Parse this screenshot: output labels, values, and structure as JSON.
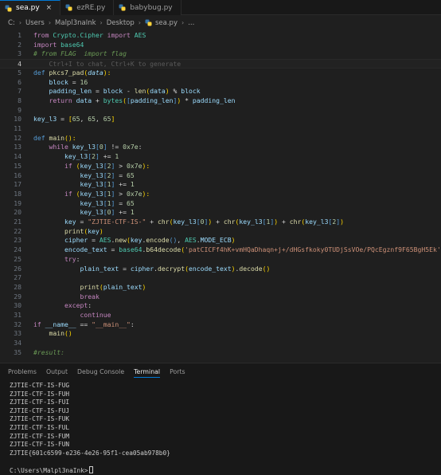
{
  "tabs": [
    {
      "label": "sea.py",
      "active": true
    },
    {
      "label": "ezRE.py",
      "active": false
    },
    {
      "label": "babybug.py",
      "active": false
    }
  ],
  "breadcrumb": [
    "C:",
    "Users",
    "Malpl3naInk",
    "Desktop",
    "sea.py",
    "..."
  ],
  "code_lines": [
    [
      [
        "kw",
        "from "
      ],
      [
        "cls",
        "Crypto.Cipher"
      ],
      [
        "kw",
        " import "
      ],
      [
        "cls",
        "AES"
      ]
    ],
    [
      [
        "kw",
        "import "
      ],
      [
        "cls",
        "base64"
      ]
    ],
    [
      [
        "cmt",
        "# from FLAG  import flag"
      ]
    ],
    [
      [
        "hint",
        "    Ctrl+I to chat, Ctrl+K to generate"
      ]
    ],
    [
      [
        "kb",
        "def "
      ],
      [
        "fn",
        "pkcs7_pad"
      ],
      [
        "pl",
        "("
      ],
      [
        "par",
        "data"
      ],
      [
        "pl",
        "):"
      ]
    ],
    [
      [
        "t",
        "    "
      ],
      [
        "var",
        "block"
      ],
      [
        "op",
        " = "
      ],
      [
        "num",
        "16"
      ]
    ],
    [
      [
        "t",
        "    "
      ],
      [
        "var",
        "padding_len"
      ],
      [
        "op",
        " = "
      ],
      [
        "var",
        "block"
      ],
      [
        "op",
        " - "
      ],
      [
        "fn",
        "len"
      ],
      [
        "pl",
        "("
      ],
      [
        "var",
        "data"
      ],
      [
        "pl",
        ")"
      ],
      [
        "op",
        " % "
      ],
      [
        "var",
        "block"
      ]
    ],
    [
      [
        "t",
        "    "
      ],
      [
        "kw",
        "return "
      ],
      [
        "var",
        "data"
      ],
      [
        "op",
        " + "
      ],
      [
        "cls",
        "bytes"
      ],
      [
        "pl",
        "("
      ],
      [
        "kb",
        "["
      ],
      [
        "var",
        "padding_len"
      ],
      [
        "kb",
        "]"
      ],
      [
        "pl",
        ")"
      ],
      [
        "op",
        " * "
      ],
      [
        "var",
        "padding_len"
      ]
    ],
    [],
    [
      [
        "var",
        "key_l3"
      ],
      [
        "op",
        " = "
      ],
      [
        "pl",
        "["
      ],
      [
        "num",
        "65"
      ],
      [
        "op",
        ", "
      ],
      [
        "num",
        "65"
      ],
      [
        "op",
        ", "
      ],
      [
        "num",
        "65"
      ],
      [
        "pl",
        "]"
      ]
    ],
    [],
    [
      [
        "kb",
        "def "
      ],
      [
        "fn",
        "main"
      ],
      [
        "pl",
        "():"
      ]
    ],
    [
      [
        "t",
        "    "
      ],
      [
        "kw",
        "while "
      ],
      [
        "var",
        "key_l3"
      ],
      [
        "kb",
        "["
      ],
      [
        "num",
        "0"
      ],
      [
        "kb",
        "]"
      ],
      [
        "op",
        " != "
      ],
      [
        "num",
        "0x7e"
      ],
      [
        "op",
        ":"
      ]
    ],
    [
      [
        "t",
        "        "
      ],
      [
        "var",
        "key_l3"
      ],
      [
        "kb",
        "["
      ],
      [
        "num",
        "2"
      ],
      [
        "kb",
        "]"
      ],
      [
        "op",
        " += "
      ],
      [
        "num",
        "1"
      ]
    ],
    [
      [
        "t",
        "        "
      ],
      [
        "kw",
        "if "
      ],
      [
        "pl",
        "("
      ],
      [
        "var",
        "key_l3"
      ],
      [
        "kb",
        "["
      ],
      [
        "num",
        "2"
      ],
      [
        "kb",
        "]"
      ],
      [
        "op",
        " > "
      ],
      [
        "num",
        "0x7e"
      ],
      [
        "pl",
        "):"
      ]
    ],
    [
      [
        "t",
        "            "
      ],
      [
        "var",
        "key_l3"
      ],
      [
        "kb",
        "["
      ],
      [
        "num",
        "2"
      ],
      [
        "kb",
        "]"
      ],
      [
        "op",
        " = "
      ],
      [
        "num",
        "65"
      ]
    ],
    [
      [
        "t",
        "            "
      ],
      [
        "var",
        "key_l3"
      ],
      [
        "kb",
        "["
      ],
      [
        "num",
        "1"
      ],
      [
        "kb",
        "]"
      ],
      [
        "op",
        " += "
      ],
      [
        "num",
        "1"
      ]
    ],
    [
      [
        "t",
        "        "
      ],
      [
        "kw",
        "if "
      ],
      [
        "pl",
        "("
      ],
      [
        "var",
        "key_l3"
      ],
      [
        "kb",
        "["
      ],
      [
        "num",
        "1"
      ],
      [
        "kb",
        "]"
      ],
      [
        "op",
        " > "
      ],
      [
        "num",
        "0x7e"
      ],
      [
        "pl",
        "):"
      ]
    ],
    [
      [
        "t",
        "            "
      ],
      [
        "var",
        "key_l3"
      ],
      [
        "kb",
        "["
      ],
      [
        "num",
        "1"
      ],
      [
        "kb",
        "]"
      ],
      [
        "op",
        " = "
      ],
      [
        "num",
        "65"
      ]
    ],
    [
      [
        "t",
        "            "
      ],
      [
        "var",
        "key_l3"
      ],
      [
        "kb",
        "["
      ],
      [
        "num",
        "0"
      ],
      [
        "kb",
        "]"
      ],
      [
        "op",
        " += "
      ],
      [
        "num",
        "1"
      ]
    ],
    [
      [
        "t",
        "        "
      ],
      [
        "var",
        "key"
      ],
      [
        "op",
        " = "
      ],
      [
        "str",
        "\"ZJTIE-CTF-IS-\""
      ],
      [
        "op",
        " + "
      ],
      [
        "fn",
        "chr"
      ],
      [
        "pl",
        "("
      ],
      [
        "var",
        "key_l3"
      ],
      [
        "kb",
        "["
      ],
      [
        "num",
        "0"
      ],
      [
        "kb",
        "]"
      ],
      [
        "pl",
        ")"
      ],
      [
        "op",
        " + "
      ],
      [
        "fn",
        "chr"
      ],
      [
        "pl",
        "("
      ],
      [
        "var",
        "key_l3"
      ],
      [
        "kb",
        "["
      ],
      [
        "num",
        "1"
      ],
      [
        "kb",
        "]"
      ],
      [
        "pl",
        ")"
      ],
      [
        "op",
        " + "
      ],
      [
        "fn",
        "chr"
      ],
      [
        "pl",
        "("
      ],
      [
        "var",
        "key_l3"
      ],
      [
        "kb",
        "["
      ],
      [
        "num",
        "2"
      ],
      [
        "kb",
        "]"
      ],
      [
        "pl",
        ")"
      ]
    ],
    [
      [
        "t",
        "        "
      ],
      [
        "fn",
        "print"
      ],
      [
        "pl",
        "("
      ],
      [
        "var",
        "key"
      ],
      [
        "pl",
        ")"
      ]
    ],
    [
      [
        "t",
        "        "
      ],
      [
        "var",
        "cipher"
      ],
      [
        "op",
        " = "
      ],
      [
        "cls",
        "AES"
      ],
      [
        "op",
        "."
      ],
      [
        "fn",
        "new"
      ],
      [
        "pl",
        "("
      ],
      [
        "var",
        "key"
      ],
      [
        "op",
        "."
      ],
      [
        "fn",
        "encode"
      ],
      [
        "kb",
        "()"
      ],
      [
        "op",
        ", "
      ],
      [
        "cls",
        "AES"
      ],
      [
        "op",
        "."
      ],
      [
        "var",
        "MODE_ECB"
      ],
      [
        "pl",
        ")"
      ]
    ],
    [
      [
        "t",
        "        "
      ],
      [
        "var",
        "encode_text"
      ],
      [
        "op",
        " = "
      ],
      [
        "cls",
        "base64"
      ],
      [
        "op",
        "."
      ],
      [
        "fn",
        "b64decode"
      ],
      [
        "pl",
        "("
      ],
      [
        "str",
        "'patCICFf4hK+vmHQaDhaqn+j+/dHGsfkoky0TUDjSsVOe/PQcEgznf9F65BgH5Ek'"
      ],
      [
        "pl",
        ")"
      ]
    ],
    [
      [
        "t",
        "        "
      ],
      [
        "kw",
        "try"
      ],
      [
        "op",
        ":"
      ]
    ],
    [
      [
        "t",
        "            "
      ],
      [
        "var",
        "plain_text"
      ],
      [
        "op",
        " = "
      ],
      [
        "var",
        "cipher"
      ],
      [
        "op",
        "."
      ],
      [
        "fn",
        "decrypt"
      ],
      [
        "pl",
        "("
      ],
      [
        "var",
        "encode_text"
      ],
      [
        "pl",
        ")"
      ],
      [
        "op",
        "."
      ],
      [
        "fn",
        "decode"
      ],
      [
        "pl",
        "()"
      ]
    ],
    [],
    [
      [
        "t",
        "            "
      ],
      [
        "fn",
        "print"
      ],
      [
        "pl",
        "("
      ],
      [
        "var",
        "plain_text"
      ],
      [
        "pl",
        ")"
      ]
    ],
    [
      [
        "t",
        "            "
      ],
      [
        "kw",
        "break"
      ]
    ],
    [
      [
        "t",
        "        "
      ],
      [
        "kw",
        "except"
      ],
      [
        "op",
        ":"
      ]
    ],
    [
      [
        "t",
        "            "
      ],
      [
        "kw",
        "continue"
      ]
    ],
    [
      [
        "kw",
        "if "
      ],
      [
        "var",
        "__name__"
      ],
      [
        "op",
        " == "
      ],
      [
        "str",
        "\"__main__\""
      ],
      [
        "op",
        ":"
      ]
    ],
    [
      [
        "t",
        "    "
      ],
      [
        "fn",
        "main"
      ],
      [
        "pl",
        "()"
      ]
    ],
    [],
    [
      [
        "cmt",
        "#result:"
      ]
    ]
  ],
  "current_line": 4,
  "panel_tabs": [
    {
      "label": "Problems",
      "active": false
    },
    {
      "label": "Output",
      "active": false
    },
    {
      "label": "Debug Console",
      "active": false
    },
    {
      "label": "Terminal",
      "active": true
    },
    {
      "label": "Ports",
      "active": false
    }
  ],
  "terminal_lines": [
    "ZJTIE-CTF-IS-FUG",
    "ZJTIE-CTF-IS-FUH",
    "ZJTIE-CTF-IS-FUI",
    "ZJTIE-CTF-IS-FUJ",
    "ZJTIE-CTF-IS-FUK",
    "ZJTIE-CTF-IS-FUL",
    "ZJTIE-CTF-IS-FUM",
    "ZJTIE-CTF-IS-FUN",
    "ZJTIE{601c6599-e236-4e26-95f1-cea05ab978b0}",
    "",
    "C:\\Users\\Malpl3naInk>"
  ],
  "colors": {
    "accent": "#0078d4",
    "python_blue": "#3572a5",
    "python_yellow": "#ffd43b"
  },
  "icons": [
    "python-file-icon",
    "chevron-right-icon",
    "close-icon",
    "terminal-cursor"
  ]
}
